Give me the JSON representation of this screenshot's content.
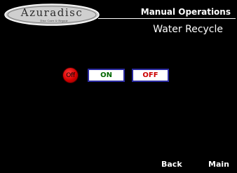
{
  "brand": {
    "logo_text": "Azuradisc",
    "tagline": "Disc Care & Repair"
  },
  "header": {
    "title": "Manual Operations",
    "subtitle": "Water Recycle"
  },
  "controls": {
    "status_indicator": {
      "label": "Off",
      "color": "#d40000"
    },
    "on_button": {
      "label": "ON",
      "text_color": "#006600"
    },
    "off_button": {
      "label": "OFF",
      "text_color": "#cc0000"
    }
  },
  "footer": {
    "back_label": "Back",
    "main_label": "Main"
  },
  "colors": {
    "background": "#000000",
    "button_border": "#2a2aa0",
    "button_face": "#ffffff"
  }
}
